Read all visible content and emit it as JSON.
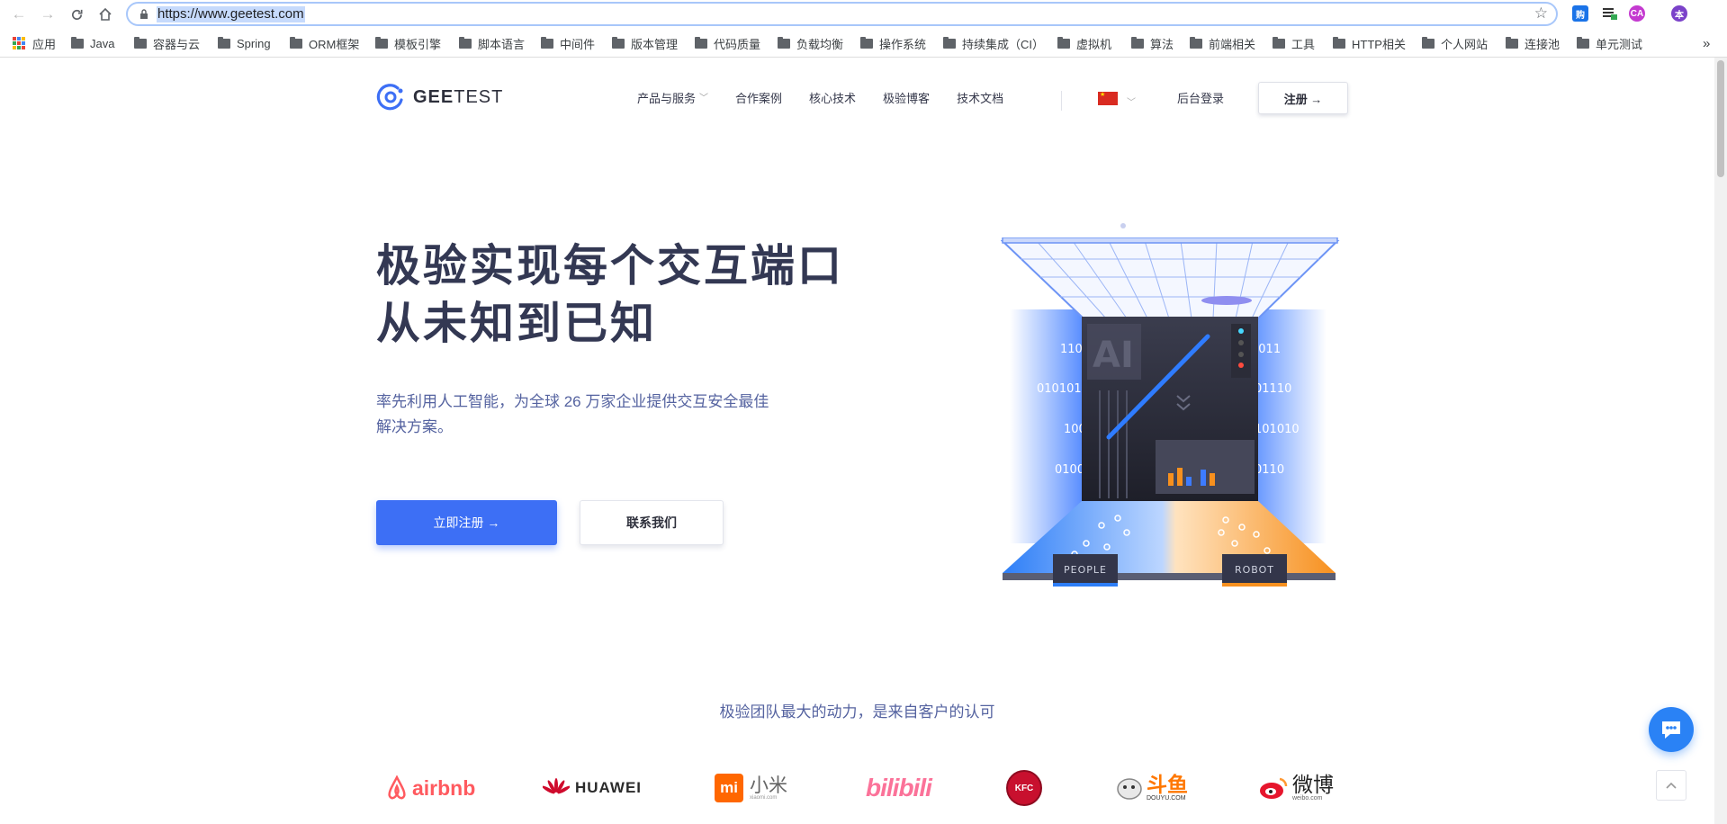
{
  "browser": {
    "url": "https://www.geetest.com",
    "bookmarks": [
      "应用",
      "Java",
      "容器与云",
      "Spring",
      "ORM框架",
      "模板引擎",
      "脚本语言",
      "中间件",
      "版本管理",
      "代码质量",
      "负载均衡",
      "操作系统",
      "持续集成（CI）",
      "虚拟机",
      "算法",
      "前端相关",
      "工具",
      "HTTP相关",
      "个人网站",
      "连接池",
      "单元测试"
    ],
    "overflow_label": "»",
    "extension_labels": [
      "购",
      "off",
      "CA",
      "本"
    ]
  },
  "site": {
    "logo": {
      "bold": "GEE",
      "rest": "TEST"
    },
    "nav": [
      "产品与服务",
      "合作案例",
      "核心技术",
      "极验博客",
      "技术文档"
    ],
    "admin_login": "后台登录",
    "register": "注册 →"
  },
  "hero": {
    "title_line1": "极验实现每个交互端口",
    "title_line2": "从未知到已知",
    "subtitle": "率先利用人工智能，为全球 26 万家企业提供交互安全最佳解决方案。",
    "cta_register": "立即注册 →",
    "cta_contact": "联系我们"
  },
  "illustration": {
    "ai_label": "AI",
    "people_label": "PEOPLE",
    "robot_label": "ROBOT",
    "binary_left": [
      "1101",
      "0101010",
      "100",
      "0100"
    ],
    "binary_right": [
      "1011",
      "01110",
      "101010",
      "0110"
    ]
  },
  "customers": {
    "title": "极验团队最大的动力，是来自客户的认可",
    "logos": [
      "airbnb",
      "HUAWEI",
      "小米",
      "xiaomi.com",
      "bilibili",
      "KFC",
      "斗鱼",
      "DOUYU.COM",
      "微博",
      "weibo.com"
    ]
  },
  "colors": {
    "brand_blue": "#3d6ff5",
    "title_navy": "#333853",
    "subtitle_blue": "#5563a0"
  }
}
